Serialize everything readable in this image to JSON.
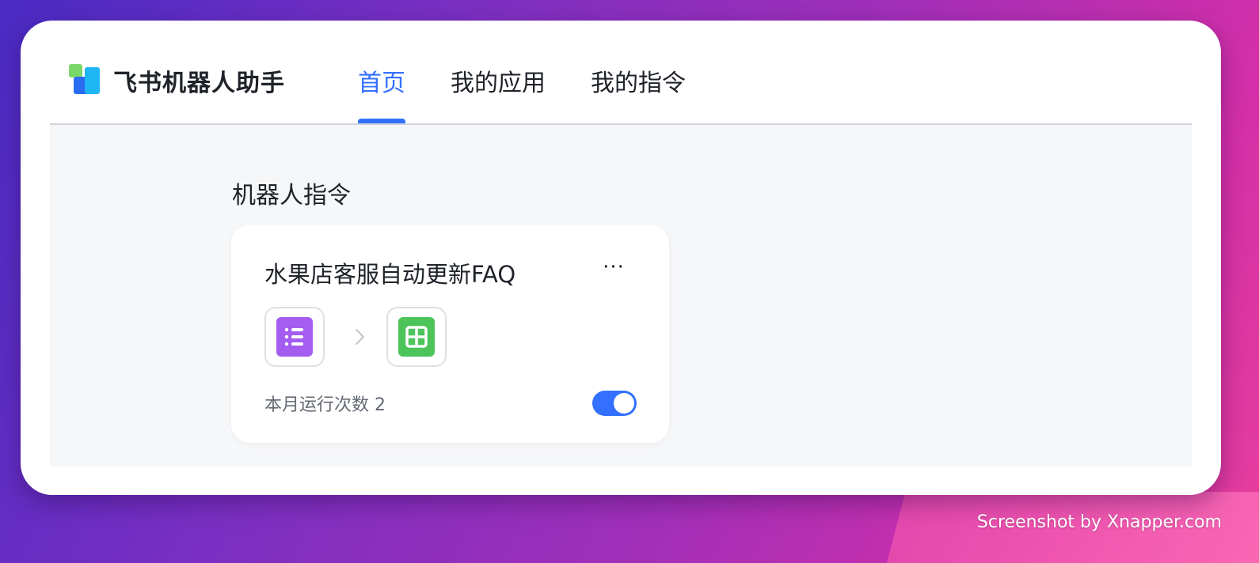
{
  "app": {
    "title": "飞书机器人助手"
  },
  "nav": {
    "tabs": [
      {
        "label": "首页",
        "active": true
      },
      {
        "label": "我的应用",
        "active": false
      },
      {
        "label": "我的指令",
        "active": false
      }
    ]
  },
  "main": {
    "section_title": "机器人指令",
    "card": {
      "title": "水果店客服自动更新FAQ",
      "more_label": "···",
      "source_app_icon": "form-icon",
      "target_app_icon": "sheet-icon",
      "runs_label": "本月运行次数 2",
      "enabled": true
    }
  },
  "watermark": "Screenshot by Xnapper.com",
  "colors": {
    "accent": "#3370ff",
    "form_icon": "#a45df0",
    "sheet_icon": "#4cc45a"
  }
}
